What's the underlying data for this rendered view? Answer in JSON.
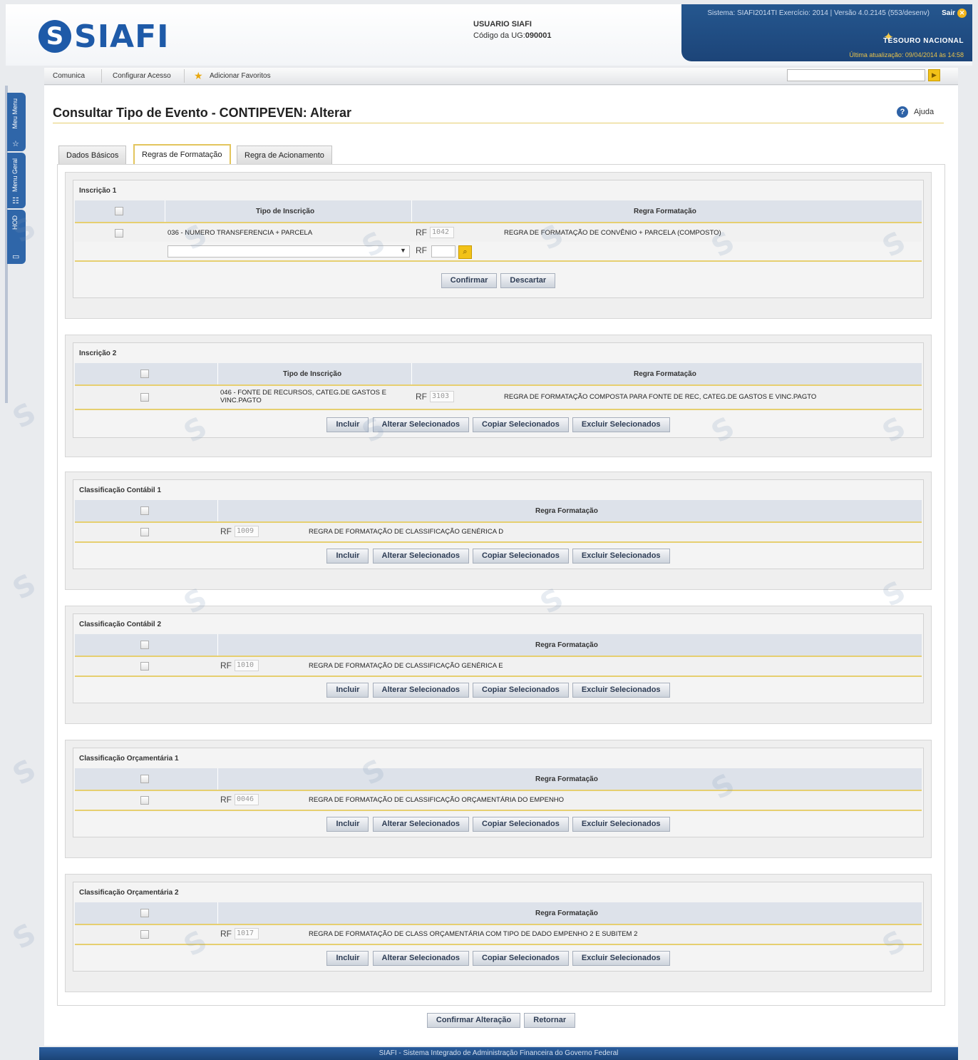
{
  "header": {
    "logo_text": "SIAFI",
    "user_name": "USUARIO SIAFI",
    "ug_label": "Código da UG:",
    "ug_code": "090001",
    "system_info": "Sistema: SIAFI2014TI Exercício: 2014 | Versão 4.0.2145 (553/desenv)",
    "exit_label": "Sair",
    "brand": "TESOURO NACIONAL",
    "last_update": "Última atualização: 09/04/2014 às 14:58"
  },
  "menu": {
    "items": [
      "Comunica",
      "Configurar Acesso",
      "Adicionar Favoritos"
    ],
    "search_value": ""
  },
  "side_tabs": [
    "Meu Menu",
    "Menu Geral",
    "HOD"
  ],
  "page": {
    "title": "Consultar Tipo de Evento - CONTIPEVEN: Alterar",
    "help_label": "Ajuda",
    "tabs": [
      "Dados Básicos",
      "Regras de Formatação",
      "Regra de Acionamento"
    ],
    "active_tab": "Regras de Formatação"
  },
  "sections": {
    "insc1": {
      "title": "Inscrição 1",
      "col_tipo": "Tipo de Inscrição",
      "col_regra": "Regra Formatação",
      "row_tipo": "036 - NUMERO TRANSFERENCIA + PARCELA",
      "row_rf_label": "RF",
      "row_rf": "1042",
      "row_regra": "REGRA DE FORMATAÇÃO DE CONVÊNIO + PARCELA (COMPOSTO)",
      "new_rf_label": "RF",
      "new_rf_value": "",
      "btn_confirm": "Confirmar",
      "btn_discard": "Descartar"
    },
    "insc2": {
      "title": "Inscrição 2",
      "col_tipo": "Tipo de Inscrição",
      "col_regra": "Regra Formatação",
      "row_tipo": "046 - FONTE DE RECURSOS, CATEG.DE GASTOS E VINC.PAGTO",
      "row_rf_label": "RF",
      "row_rf": "3103",
      "row_regra": "REGRA DE FORMATAÇÃO COMPOSTA PARA FONTE DE REC, CATEG.DE GASTOS E VINC.PAGTO"
    },
    "cc1": {
      "title": "Classificação Contábil 1",
      "col_regra": "Regra Formatação",
      "row_rf_label": "RF",
      "row_rf": "1009",
      "row_regra": "REGRA DE FORMATAÇÃO DE CLASSIFICAÇÃO GENÉRICA D"
    },
    "cc2": {
      "title": "Classificação Contábil 2",
      "col_regra": "Regra Formatação",
      "row_rf_label": "RF",
      "row_rf": "1010",
      "row_regra": "REGRA DE FORMATAÇÃO DE CLASSIFICAÇÃO GENÉRICA E"
    },
    "co1": {
      "title": "Classificação Orçamentária 1",
      "col_regra": "Regra Formatação",
      "row_rf_label": "RF",
      "row_rf": "0046",
      "row_regra": "REGRA DE FORMATAÇÃO DE CLASSIFICAÇÃO ORÇAMENTÁRIA DO EMPENHO"
    },
    "co2": {
      "title": "Classificação Orçamentária 2",
      "col_regra": "Regra Formatação",
      "row_rf_label": "RF",
      "row_rf": "1017",
      "row_regra": "REGRA DE FORMATAÇÃO DE CLASS ORÇAMENTÁRIA COM TIPO DE DADO EMPENHO 2 E SUBITEM 2"
    }
  },
  "actions": {
    "incluir": "Incluir",
    "alterar": "Alterar Selecionados",
    "copiar": "Copiar Selecionados",
    "excluir": "Excluir Selecionados"
  },
  "bottom": {
    "confirm": "Confirmar Alteração",
    "back": "Retornar"
  },
  "footer": "SIAFI - Sistema Integrado de Administração Financeira do Governo Federal",
  "colors": {
    "brand_blue": "#1e5aa8",
    "accent_gold": "#e6cf70",
    "header_dark": "#1c4478"
  }
}
